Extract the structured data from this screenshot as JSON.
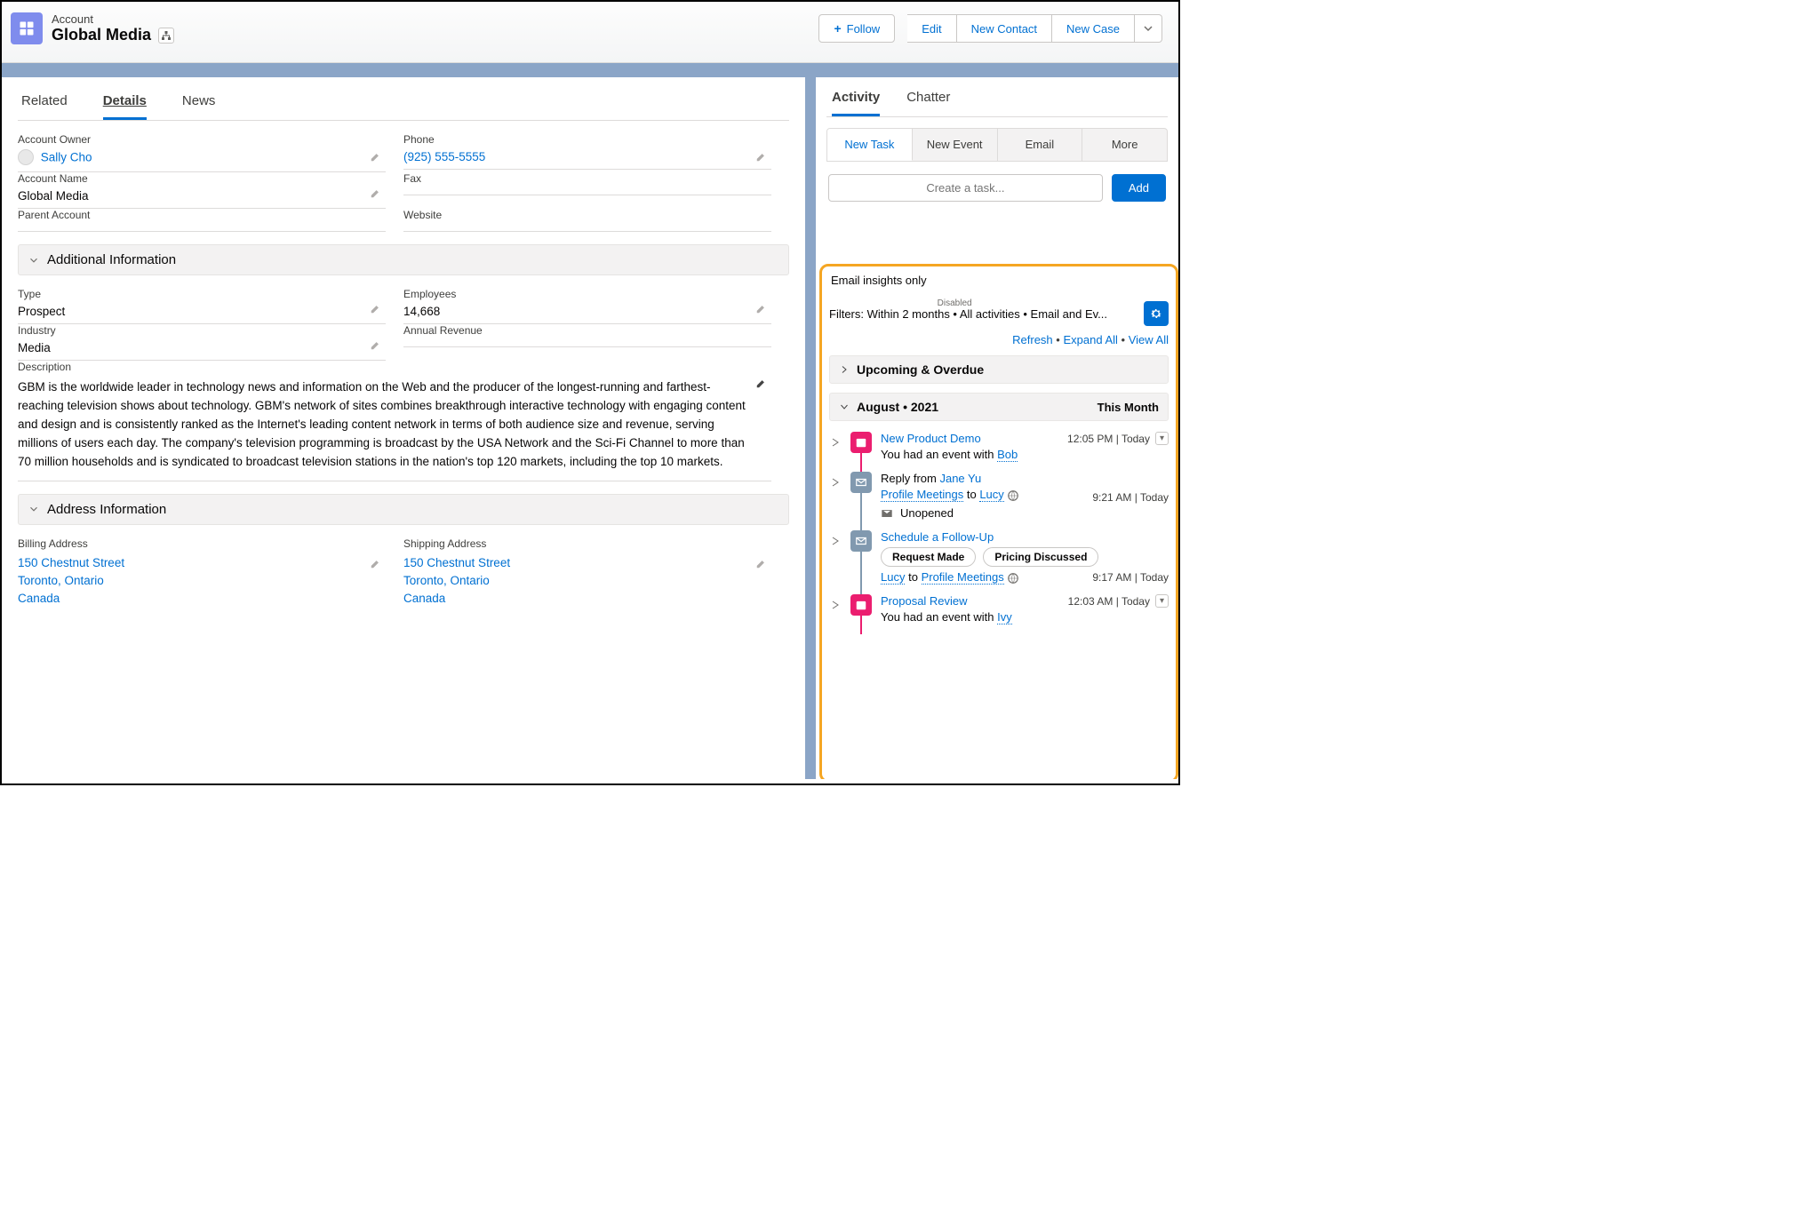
{
  "header": {
    "entity_label": "Account",
    "title": "Global Media",
    "actions": {
      "follow": "Follow",
      "edit": "Edit",
      "new_contact": "New Contact",
      "new_case": "New Case"
    }
  },
  "main_tabs": {
    "related": "Related",
    "details": "Details",
    "news": "News"
  },
  "fields": {
    "account_owner": {
      "label": "Account Owner",
      "value": "Sally Cho"
    },
    "phone": {
      "label": "Phone",
      "value": "(925) 555-5555"
    },
    "account_name": {
      "label": "Account Name",
      "value": "Global Media"
    },
    "fax": {
      "label": "Fax",
      "value": ""
    },
    "parent_account": {
      "label": "Parent Account",
      "value": ""
    },
    "website": {
      "label": "Website",
      "value": ""
    }
  },
  "sections": {
    "additional": "Additional Information",
    "address": "Address Information"
  },
  "additional": {
    "type": {
      "label": "Type",
      "value": "Prospect"
    },
    "employees": {
      "label": "Employees",
      "value": "14,668"
    },
    "industry": {
      "label": "Industry",
      "value": "Media"
    },
    "annual_revenue": {
      "label": "Annual Revenue",
      "value": ""
    },
    "description": {
      "label": "Description",
      "value": "GBM is the worldwide leader in technology news and information on the Web and the producer of the longest-running and farthest-reaching television shows about technology. GBM's network of sites combines breakthrough interactive technology with engaging content and design and is consistently ranked as the Internet's leading content network in terms of both audience size and revenue, serving millions of users each day. The company's television programming is broadcast by the USA Network and the Sci-Fi Channel to more than 70 million households and is syndicated to broadcast television stations in the nation's top 120 markets, including the top 10 markets."
    }
  },
  "address": {
    "billing": {
      "label": "Billing Address",
      "street": "150 Chestnut Street",
      "city": "Toronto, Ontario",
      "country": "Canada"
    },
    "shipping": {
      "label": "Shipping Address",
      "street": "150 Chestnut Street",
      "city": "Toronto, Ontario",
      "country": "Canada"
    }
  },
  "side_tabs": {
    "activity": "Activity",
    "chatter": "Chatter"
  },
  "action_tabs": {
    "new_task": "New Task",
    "new_event": "New Event",
    "email": "Email",
    "more": "More"
  },
  "task": {
    "placeholder": "Create a task...",
    "add": "Add"
  },
  "insights": {
    "label": "Email insights only",
    "state": "Disabled"
  },
  "filters": "Filters: Within 2 months • All activities • Email and Ev...",
  "links": {
    "refresh": "Refresh",
    "expand": "Expand All",
    "view": "View All"
  },
  "groups": {
    "upcoming": "Upcoming & Overdue",
    "month": "August  •  2021",
    "month_badge": "This Month"
  },
  "timeline": [
    {
      "icon": "cal",
      "title": "New Product Demo",
      "time": "12:05 PM | Today",
      "sub_prefix": "You had an event with ",
      "sub_link": "Bob",
      "dropdown": true
    },
    {
      "icon": "mail",
      "title_prefix": "Reply from ",
      "title_link": "Jane Yu",
      "from": "Profile Meetings",
      "to_word": "to",
      "to": "Lucy",
      "time": "9:21 AM | Today",
      "unopened": "Unopened"
    },
    {
      "icon": "mail",
      "title": "Schedule a Follow-Up",
      "chips": [
        "Request Made",
        "Pricing Discussed"
      ],
      "from": "Lucy",
      "to_word": "to",
      "to": "Profile Meetings",
      "time": "9:17 AM | Today"
    },
    {
      "icon": "cal",
      "title": "Proposal Review",
      "time": "12:03 AM | Today",
      "sub_prefix": "You had an event with ",
      "sub_link": "Ivy",
      "dropdown": true
    }
  ]
}
